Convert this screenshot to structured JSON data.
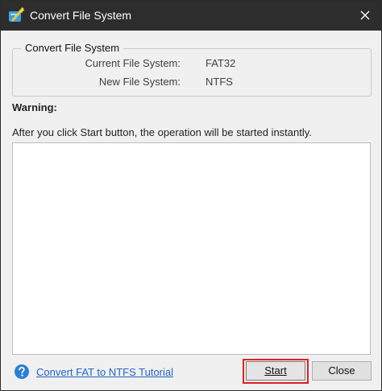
{
  "window": {
    "title": "Convert File System",
    "icons": {
      "app": "wand-app-icon",
      "close": "close-icon",
      "help": "help-circle-icon"
    },
    "colors": {
      "titlebar": "#2d2d2d",
      "link": "#1e64c8",
      "highlight": "#e02020",
      "help_icon": "#2a7fd4"
    }
  },
  "group": {
    "legend": "Convert File System",
    "current_label": "Current File System:",
    "current_value": "FAT32",
    "new_label": "New File System:",
    "new_value": "NTFS"
  },
  "warning": {
    "heading": "Warning:",
    "message": "After you click Start button, the operation will be started instantly."
  },
  "footer": {
    "tutorial_link": "Convert FAT to NTFS Tutorial",
    "start_label": "Start",
    "close_label": "Close"
  }
}
